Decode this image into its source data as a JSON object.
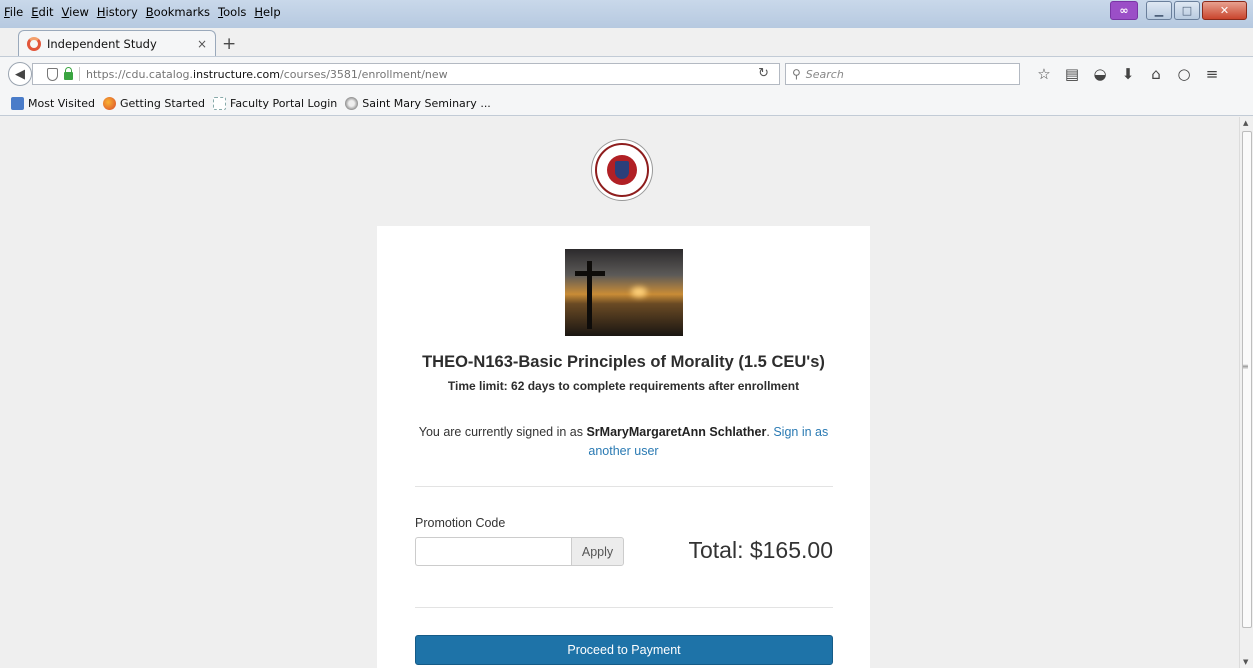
{
  "browser": {
    "menu": [
      "File",
      "Edit",
      "View",
      "History",
      "Bookmarks",
      "Tools",
      "Help"
    ],
    "tab": {
      "title": "Independent Study",
      "close": "×"
    },
    "new_tab": "+",
    "url": {
      "prefix": "https://cdu.catalog.",
      "domain": "instructure.com",
      "path": "/courses/3581/enrollment/new"
    },
    "search_placeholder": "Search",
    "bookmarks": [
      "Most Visited",
      "Getting Started",
      "Faculty Portal Login",
      "Saint Mary Seminary ..."
    ]
  },
  "page": {
    "course_title": "THEO-N163-Basic Principles of Morality (1.5 CEU's)",
    "time_limit": "Time limit: 62 days to complete requirements after enrollment",
    "signed_in_prefix": "You are currently signed in as ",
    "username": "SrMaryMargaretAnn Schlather",
    "signed_in_sep": ". ",
    "sign_in_link": "Sign in as another user",
    "promo_label": "Promotion Code",
    "promo_value": "",
    "apply_label": "Apply",
    "total_label": "Total: $165.00",
    "pay_label": "Proceed to Payment"
  },
  "colors": {
    "primary_button": "#1e73a8",
    "link": "#2a7ab3"
  }
}
